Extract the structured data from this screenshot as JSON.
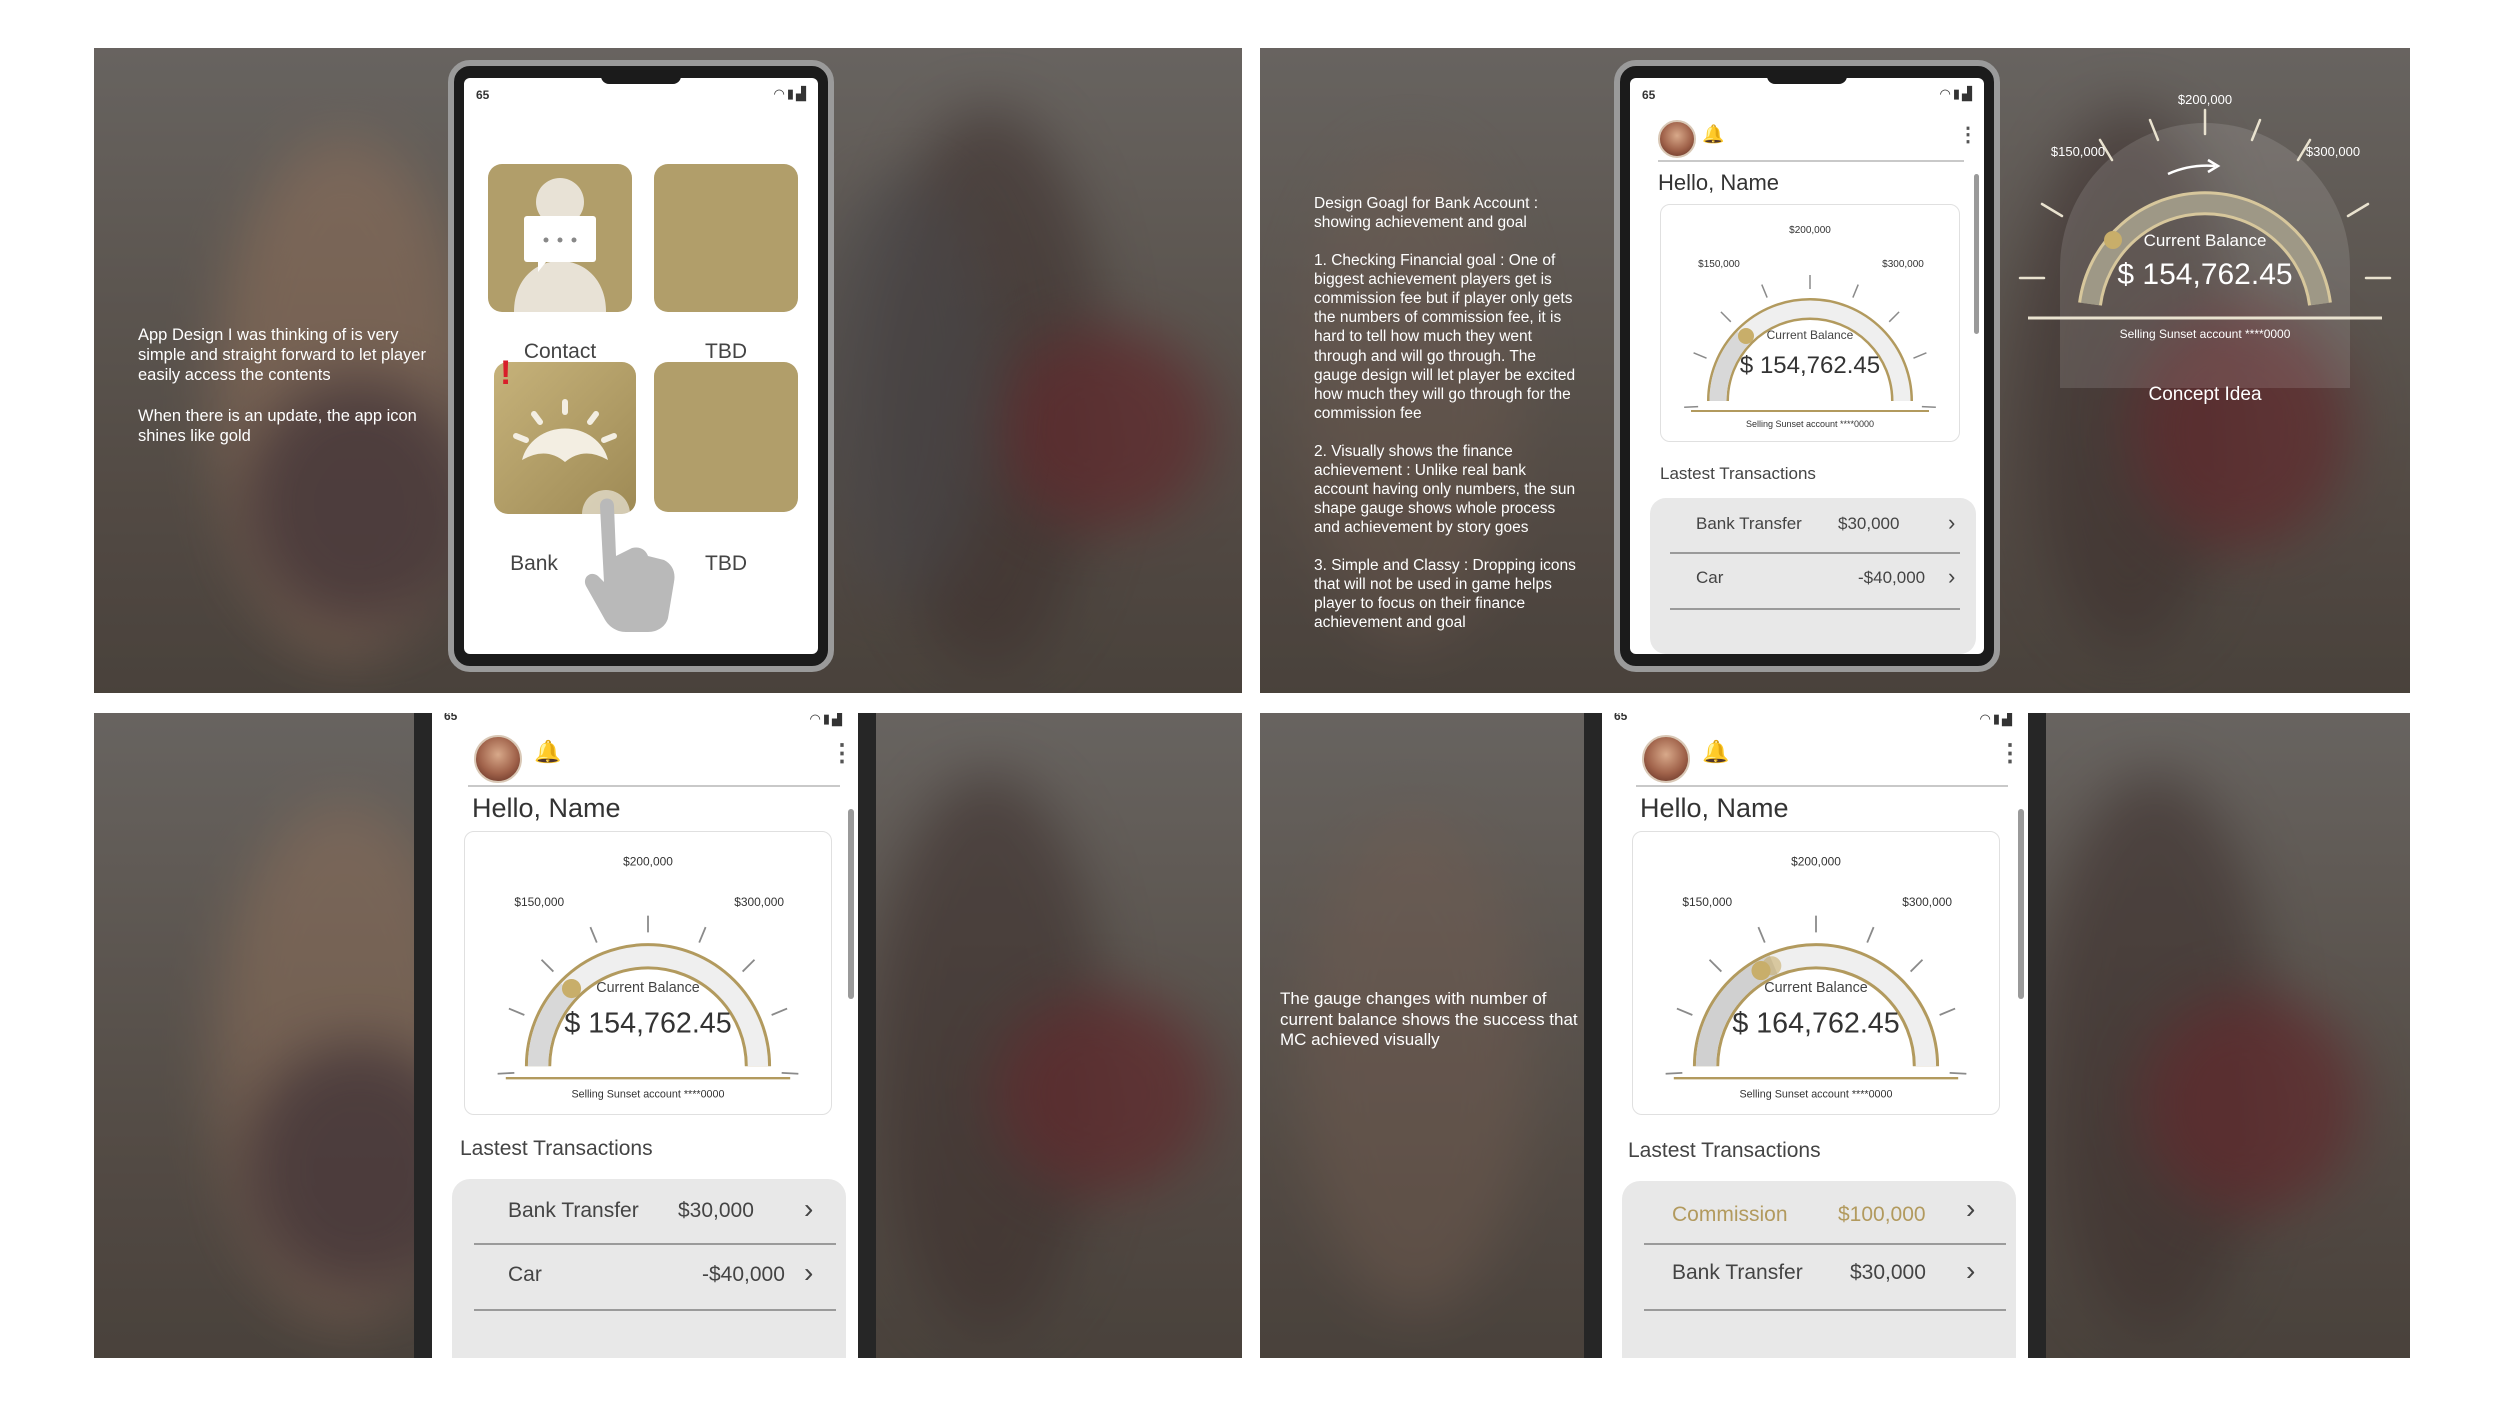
{
  "panel1": {
    "note": "App Design I was thinking of is very simple and straight forward to let player easily access the contents\n\nWhen there is an update, the app icon shines like gold",
    "status_left": "65",
    "apps": [
      {
        "label": "Contact",
        "icon": "contact-card-icon"
      },
      {
        "label": "TBD",
        "icon": ""
      },
      {
        "label": "Bank",
        "icon": "sunset-icon",
        "badge": "!"
      },
      {
        "label": "TBD",
        "icon": ""
      }
    ]
  },
  "panel2": {
    "note": "Design Goagl for Bank Account : showing achievement and goal\n\n1. Checking Financial goal : One of biggest achievement players get is commission fee but if player only gets the numbers of commission fee, it is hard to tell how much they went through and will go through. The gauge design will let player be excited how much they will go through for the commission fee\n\n2. Visually shows the finance achievement : Unlike real bank account having only numbers, the sun shape gauge shows whole process and achievement by story goes\n\n3. Simple and Classy : Dropping icons that will not be used in game helps player to focus on their finance achievement and goal",
    "concept_label": "Concept Idea"
  },
  "panel4": {
    "note": "The gauge changes with number of current balance shows the success that MC achieved visually"
  },
  "bank": {
    "status_left": "65",
    "greeting": "Hello, Name",
    "gauge_top": "$200,000",
    "gauge_left": "$150,000",
    "gauge_right": "$300,000",
    "balance_label": "Current Balance",
    "balance": "$ 154,762.45",
    "balance_updated": "$ 164,762.45",
    "account": "Selling Sunset account ****0000",
    "tx_title": "Lastest Transactions",
    "tx": [
      {
        "name": "Bank Transfer",
        "amount": "$30,000"
      },
      {
        "name": "Car",
        "amount": "-$40,000"
      }
    ],
    "tx_updated": [
      {
        "name": "Commission",
        "amount": "$100,000"
      },
      {
        "name": "Bank Transfer",
        "amount": "$30,000"
      }
    ],
    "gold": "#b29a5e"
  }
}
